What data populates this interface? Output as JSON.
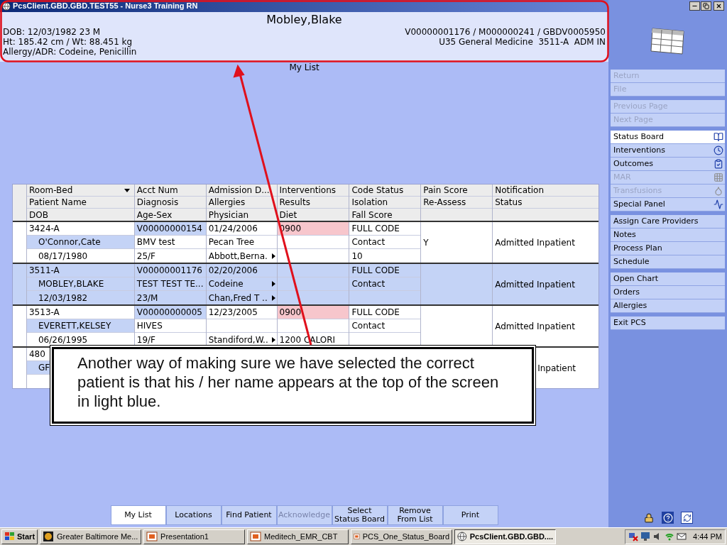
{
  "window": {
    "title": "PcsClient.GBD.GBD.TEST55 - Nurse3 Training RN"
  },
  "patient_header": {
    "name": "Mobley,Blake",
    "dob": "DOB: 12/03/1982 23 M",
    "height_weight": "Ht: 185.42 cm / Wt: 88.451 kg",
    "allergy": "Allergy/ADR: Codeine, Penicillin",
    "account": "V00000001176 / M000000241 / GBDV0005950",
    "location": "U35 General Medicine  3511-A  ADM IN"
  },
  "list_title": "My List",
  "table": {
    "columns": [
      {
        "lines": [
          "Room-Bed",
          "Patient Name",
          "DOB"
        ],
        "sorted": true
      },
      {
        "lines": [
          "Acct Num",
          "Diagnosis",
          "Age-Sex"
        ],
        "sorted": false
      },
      {
        "lines": [
          "Admission D...",
          "Allergies",
          "Physician"
        ],
        "sorted": false
      },
      {
        "lines": [
          "Interventions",
          "Results",
          "Diet"
        ],
        "sorted": false
      },
      {
        "lines": [
          "Code Status",
          "Isolation",
          "Fall Score"
        ],
        "sorted": false
      },
      {
        "lines": [
          "Pain Score",
          "Re-Assess"
        ],
        "sorted": false
      },
      {
        "lines": [
          "Notification",
          "Status"
        ],
        "sorted": false
      }
    ],
    "patients": [
      {
        "room": "3424-A",
        "name": "O'Connor,Cate",
        "dob": "08/17/1980",
        "acct": "V00000000154",
        "diagnosis": "BMV test",
        "age_sex": "25/F",
        "admission": "01/24/2006",
        "allergies": "Pecan Tree",
        "physician": "Abbott,Berna.",
        "interventions": "0900",
        "code_status": "FULL CODE",
        "isolation": "Contact",
        "fall_score": "10",
        "reassess": "Y",
        "status": "Admitted Inpatient",
        "selected": false,
        "interventions_due": true,
        "allergies_more": false,
        "physician_more": true,
        "cut_off": false
      },
      {
        "room": "3511-A",
        "name": "MOBLEY,BLAKE",
        "dob": "12/03/1982",
        "acct": "V00000001176",
        "diagnosis": "TEST TEST TE...",
        "age_sex": "23/M",
        "admission": "02/20/2006",
        "allergies": "Codeine",
        "physician": "Chan,Fred T ..",
        "code_status": "FULL CODE",
        "isolation": "Contact",
        "status": "Admitted Inpatient",
        "selected": true,
        "interventions_due": false,
        "allergies_more": true,
        "physician_more": true,
        "cut_off": false
      },
      {
        "room": "3513-A",
        "name": "EVERETT,KELSEY",
        "dob": "06/26/1995",
        "acct": "V00000000005",
        "diagnosis": "HIVES",
        "age_sex": "19/F",
        "admission": "12/23/2005",
        "physician": "Standiford,W..",
        "interventions": "0900",
        "diet": "1200 CALORI",
        "code_status": "FULL CODE",
        "isolation": "Contact",
        "status": "Admitted Inpatient",
        "selected": false,
        "interventions_due": true,
        "allergies_more": false,
        "physician_more": true,
        "cut_off": false
      },
      {
        "room": "480",
        "name": "GF",
        "status": "Inpatient",
        "selected": false,
        "interventions_due": false,
        "allergies_more": false,
        "physician_more": false,
        "cut_off": true
      }
    ]
  },
  "callout": {
    "text": "Another way of making sure we have selected the correct patient is that his / her name appears at the top of the screen in light blue."
  },
  "sidebar": {
    "groups": [
      [
        {
          "label": "Return",
          "disabled": true,
          "selected": false
        },
        {
          "label": "File",
          "disabled": true,
          "selected": false
        }
      ],
      [
        {
          "label": "Previous Page",
          "disabled": true,
          "selected": false
        },
        {
          "label": "Next Page",
          "disabled": true,
          "selected": false
        }
      ],
      [
        {
          "label": "Status Board",
          "disabled": false,
          "selected": true,
          "kind": "book"
        },
        {
          "label": "Interventions",
          "disabled": false,
          "selected": false,
          "kind": "clock"
        },
        {
          "label": "Outcomes",
          "disabled": false,
          "selected": false,
          "kind": "check"
        },
        {
          "label": "MAR",
          "disabled": true,
          "selected": false,
          "kind": "grid"
        },
        {
          "label": "Transfusions",
          "disabled": true,
          "selected": false,
          "kind": "drop"
        },
        {
          "label": "Special Panel",
          "disabled": false,
          "selected": false,
          "kind": "pulse"
        }
      ],
      [
        {
          "label": "Assign Care Providers",
          "disabled": false,
          "selected": false
        },
        {
          "label": "Notes",
          "disabled": false,
          "selected": false
        },
        {
          "label": "Process Plan",
          "disabled": false,
          "selected": false
        },
        {
          "label": "Schedule",
          "disabled": false,
          "selected": false
        }
      ],
      [
        {
          "label": "Open Chart",
          "disabled": false,
          "selected": false
        },
        {
          "label": "Orders",
          "disabled": false,
          "selected": false
        },
        {
          "label": "Allergies",
          "disabled": false,
          "selected": false
        }
      ],
      [
        {
          "label": "Exit PCS",
          "disabled": false,
          "selected": false
        }
      ]
    ]
  },
  "toolbar": [
    {
      "label": "My List",
      "selected": true,
      "disabled": false
    },
    {
      "label": "Locations",
      "selected": false,
      "disabled": false
    },
    {
      "label": "Find Patient",
      "selected": false,
      "disabled": false
    },
    {
      "label": "Acknowledge",
      "selected": false,
      "disabled": true
    },
    {
      "label": "Select\nStatus Board",
      "selected": false,
      "disabled": false
    },
    {
      "label": "Remove\nFrom List",
      "selected": false,
      "disabled": false
    },
    {
      "label": "Print",
      "selected": false,
      "disabled": false
    }
  ],
  "taskbar": {
    "start": "Start",
    "tasks": [
      {
        "label": "Greater Baltimore Me...",
        "kind": "logo",
        "selected": false
      },
      {
        "label": "Presentation1",
        "kind": "slides",
        "selected": false
      },
      {
        "label": "Meditech_EMR_CBT",
        "kind": "slides",
        "selected": false
      },
      {
        "label": "PCS_One_Status_Board",
        "kind": "slides",
        "selected": false
      },
      {
        "label": "PcsClient.GBD.GBD....",
        "kind": "globe",
        "selected": true
      }
    ],
    "clock": "4:44 PM"
  }
}
